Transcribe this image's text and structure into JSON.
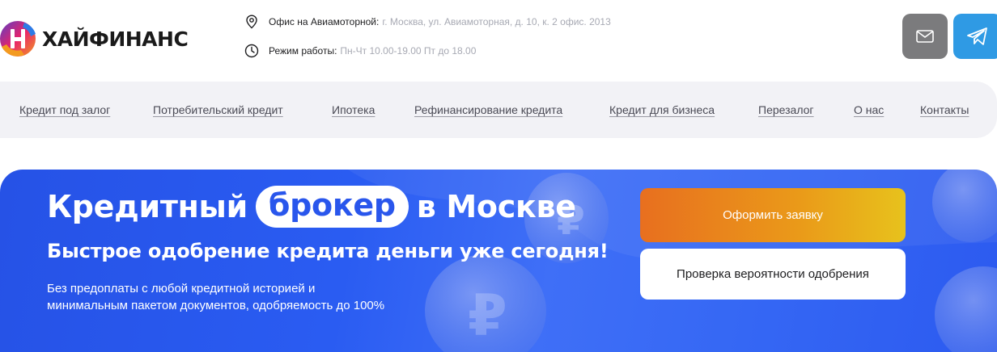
{
  "brand": {
    "name": "ХАЙФИНАНС",
    "colors": {
      "logo_pink": "#e8226b",
      "logo_orange": "#f39a1f",
      "logo_purple": "#5a3fc4",
      "logo_blue": "#2d7be6"
    }
  },
  "contacts": {
    "office": {
      "icon": "location-pin-icon",
      "label": "Офис на Авиамоторной:",
      "value": "г. Москва, ул. Авиамоторная, д. 10, к. 2 офис. 2013"
    },
    "hours": {
      "icon": "clock-icon",
      "label": "Режим работы:",
      "value": "Пн-Чт 10.00-19.00 Пт до 18.00"
    }
  },
  "header_buttons": {
    "mail": {
      "icon": "mail-icon",
      "color": "#7b7b7d"
    },
    "telegram": {
      "icon": "telegram-icon",
      "color": "#2f9ae4"
    }
  },
  "nav": {
    "items": [
      {
        "label": "Кредит под залог"
      },
      {
        "label": "Потребительский кредит"
      },
      {
        "label": "Ипотека"
      },
      {
        "label": "Рефинансирование кредита"
      },
      {
        "label": "Кредит для бизнеса"
      },
      {
        "label": "Перезалог"
      },
      {
        "label": "О нас"
      },
      {
        "label": "Контакты"
      }
    ]
  },
  "hero": {
    "title_before": "Кредитный",
    "title_highlight": "брокер",
    "title_after": "в Москве",
    "subtitle": "Быстрое одобрение кредита деньги уже сегодня!",
    "description": "Без предоплаты с любой кредитной историей и минимальным пакетом документов, одобряемость до 100%",
    "cta_primary": "Оформить заявку",
    "cta_secondary": "Проверка вероятности одобрения",
    "colors": {
      "background": "#2a5cf2",
      "cta_orange": "#e86f1f",
      "cta_yellow": "#e7c21c",
      "highlight_text": "#2956ec"
    }
  }
}
